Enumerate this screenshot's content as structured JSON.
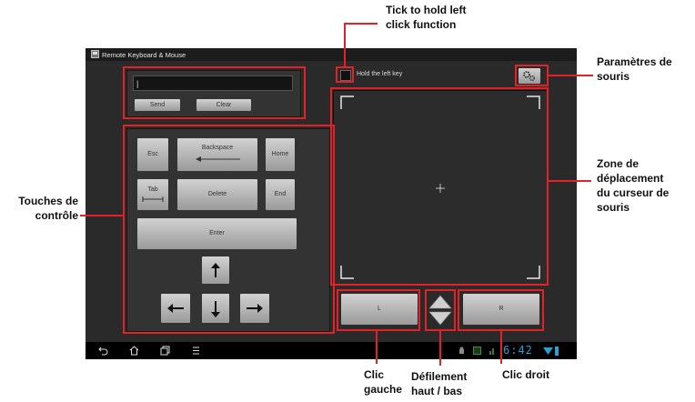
{
  "app": {
    "title": "Remote Keyboard & Mouse"
  },
  "send_area": {
    "input_value": "|",
    "send_label": "Send",
    "clear_label": "Clear"
  },
  "keys": {
    "esc": "Esc",
    "backspace": "Backspace",
    "home": "Home",
    "tab": "Tab",
    "delete": "Delete",
    "end": "End",
    "enter": "Enter"
  },
  "hold": {
    "label": "Hold the left key",
    "checked": false
  },
  "mouse": {
    "left_label": "L",
    "right_label": "R"
  },
  "status": {
    "time": "6:42"
  },
  "annotations": {
    "tick_hold": [
      "Tick to hold left",
      "click function"
    ],
    "parametres": [
      "Paramètres de",
      "souris"
    ],
    "zone": [
      "Zone de",
      "déplacement",
      "du curseur de",
      "souris"
    ],
    "touches": [
      "Touches de",
      "contrôle"
    ],
    "clic_gauche": [
      "Clic",
      "gauche"
    ],
    "defilement": [
      "Défilement",
      "haut / bas"
    ],
    "clic_droit": "Clic droit"
  },
  "colors": {
    "callout_red": "#e32228",
    "screen_bg": "#2a2a2a",
    "key_light": "#d2d2d2",
    "status_blue": "#33b5e5"
  },
  "icons": [
    "app-icon",
    "gear-icon",
    "back-icon",
    "home-icon",
    "recent-apps-icon",
    "menu-icon",
    "arrow-up-icon",
    "arrow-left-icon",
    "arrow-down-icon",
    "arrow-right-icon",
    "scroll-up-icon",
    "scroll-down-icon",
    "wifi-icon",
    "battery-icon"
  ]
}
